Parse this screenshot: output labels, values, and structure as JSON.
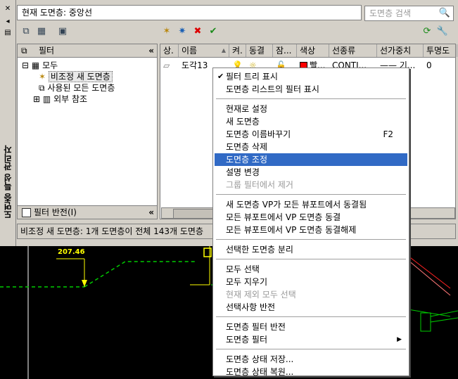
{
  "window": {
    "sidebar_title": "도면층 특성 관리자",
    "current_layer_label": "현재 도면층: 중앙선",
    "search_placeholder": "도면층 검색",
    "status_text": "비조정 새 도면층: 1개 도면층이 전체 143개 도면층"
  },
  "filter_pane": {
    "header": "필터",
    "items": [
      {
        "label": "모두"
      },
      {
        "label": "비조정 새 도면층"
      },
      {
        "label": "사용된 모든 도면층"
      },
      {
        "label": "외부 참조"
      }
    ],
    "invert_label": "필터 반전(I)"
  },
  "layer_table": {
    "columns": [
      "상.",
      "이름",
      "켜.",
      "동결",
      "잠...",
      "색상",
      "선종류",
      "선가중치",
      "투명도"
    ],
    "rows": [
      {
        "name": "도각13",
        "color": "빨...",
        "linetype": "CONTI...",
        "lineweight": "—— 기...",
        "transparency": "0"
      }
    ]
  },
  "context_menu": {
    "groups": [
      [
        {
          "label": "필터 트리 표시",
          "checked": true
        },
        {
          "label": "도면층 리스트의 필터 표시"
        }
      ],
      [
        {
          "label": "현재로 설정"
        },
        {
          "label": "새 도면층"
        },
        {
          "label": "도면층 이름바꾸기",
          "shortcut": "F2"
        },
        {
          "label": "도면층 삭제"
        },
        {
          "label": "도면층 조정",
          "highlighted": true
        },
        {
          "label": "설명 변경"
        },
        {
          "label": "그룹 필터에서 제거",
          "disabled": true
        }
      ],
      [
        {
          "label": "새 도면층 VP가 모든 뷰포트에서 동결됨"
        },
        {
          "label": "모든 뷰포트에서 VP 도면층 동결"
        },
        {
          "label": "모든 뷰포트에서 VP 도면층 동결해제"
        }
      ],
      [
        {
          "label": "선택한 도면층 분리"
        }
      ],
      [
        {
          "label": "모두 선택"
        },
        {
          "label": "모두 지우기"
        },
        {
          "label": "현재 제외 모두 선택",
          "disabled": true
        },
        {
          "label": "선택사항 반전"
        }
      ],
      [
        {
          "label": "도면층 필터 반전"
        },
        {
          "label": "도면층 필터",
          "submenu": true
        }
      ],
      [
        {
          "label": "도면층 상태 저장..."
        },
        {
          "label": "도면층 상태 복원..."
        }
      ]
    ]
  },
  "drawing": {
    "dimension_text": "207.46"
  }
}
